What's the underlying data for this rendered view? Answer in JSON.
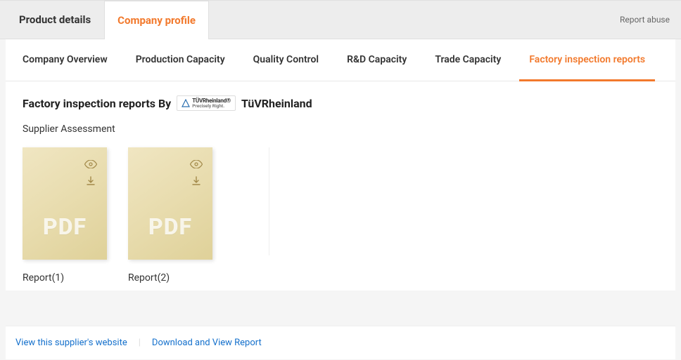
{
  "header": {
    "tabs": [
      {
        "label": "Product details"
      },
      {
        "label": "Company profile"
      }
    ],
    "report_abuse": "Report abuse"
  },
  "subnav": {
    "items": [
      {
        "label": "Company Overview"
      },
      {
        "label": "Production Capacity"
      },
      {
        "label": "Quality Control"
      },
      {
        "label": "R&D Capacity"
      },
      {
        "label": "Trade Capacity"
      },
      {
        "label": "Factory inspection reports"
      }
    ]
  },
  "section": {
    "title_prefix": "Factory inspection reports By",
    "tuv_brand": "TÜVRheinland®",
    "tuv_tagline": "Precisely Right.",
    "provider": "TüVRheinland",
    "sub_heading": "Supplier Assessment"
  },
  "reports": [
    {
      "file_label": "PDF",
      "caption": "Report(1)"
    },
    {
      "file_label": "PDF",
      "caption": "Report(2)"
    }
  ],
  "footer": {
    "view_site": "View this supplier's website",
    "download": "Download and View Report"
  }
}
